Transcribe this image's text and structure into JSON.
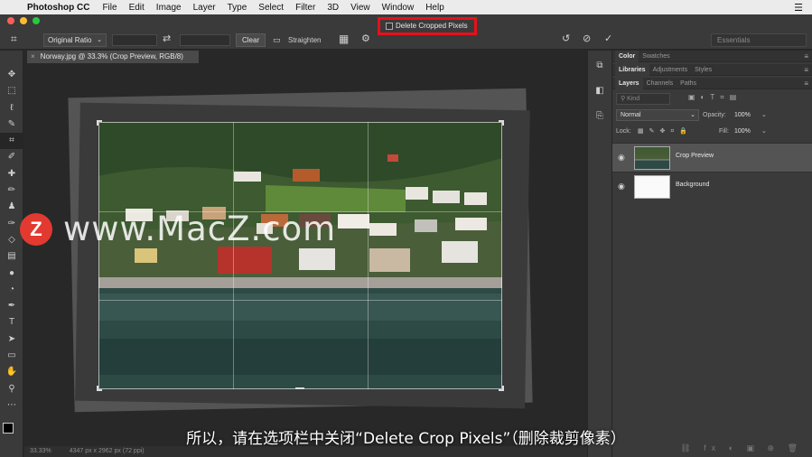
{
  "menubar": {
    "app_name": "Photoshop CC",
    "items": [
      "File",
      "Edit",
      "Image",
      "Layer",
      "Type",
      "Select",
      "Filter",
      "3D",
      "View",
      "Window",
      "Help"
    ],
    "right_icon": "list-icon"
  },
  "options_bar": {
    "ratio_select": "Original Ratio",
    "clear_label": "Clear",
    "straighten_label": "Straighten",
    "delete_cropped_label": "Delete Cropped Pixels",
    "delete_cropped_checked": false,
    "workspace": "Essentials",
    "highlight_color": "#e8101a"
  },
  "document": {
    "tab_title": "Norway.jpg @ 33.3% (Crop Preview, RGB/8)",
    "status_zoom": "33.33%",
    "status_info": "4347 px x 2962 px (72 ppi)"
  },
  "panels": {
    "top_tabs": [
      "Color",
      "Swatches"
    ],
    "mid_tabs": [
      "Libraries",
      "Adjustments",
      "Styles"
    ],
    "layer_tabs": [
      "Layers",
      "Channels",
      "Paths"
    ],
    "kind_placeholder": "Kind",
    "blend_mode": "Normal",
    "opacity_label": "Opacity:",
    "opacity_value": "100%",
    "lock_label": "Lock:",
    "fill_label": "Fill:",
    "fill_value": "100%",
    "layers": [
      {
        "name": "Crop Preview",
        "selected": true
      },
      {
        "name": "Background",
        "selected": false
      }
    ]
  },
  "watermark": {
    "logo_letter": "Z",
    "text": "www.MacZ.com"
  },
  "subtitle": "所以，请在选项栏中关闭“Delete Crop Pixels”（删除裁剪像素）"
}
